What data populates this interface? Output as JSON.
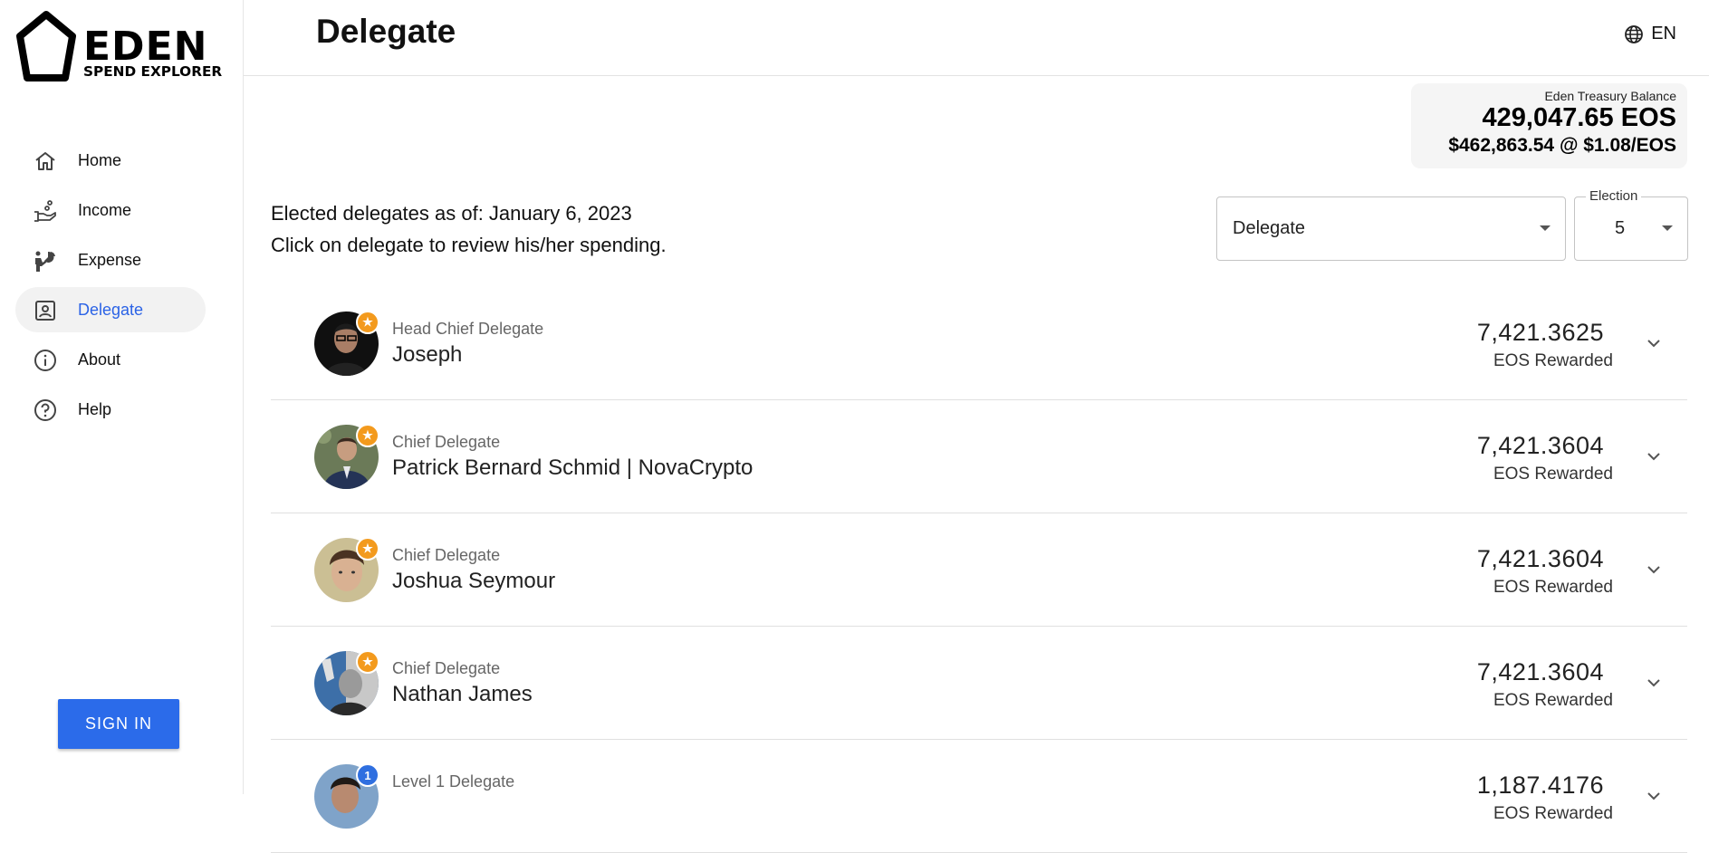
{
  "brand": {
    "name": "EDEN",
    "subtitle": "SPEND EXPLORER"
  },
  "sidebar": {
    "items": [
      {
        "label": "Home",
        "icon": "home-icon",
        "active": false
      },
      {
        "label": "Income",
        "icon": "income-icon",
        "active": false
      },
      {
        "label": "Expense",
        "icon": "expense-icon",
        "active": false
      },
      {
        "label": "Delegate",
        "icon": "delegate-icon",
        "active": true
      },
      {
        "label": "About",
        "icon": "info-icon",
        "active": false
      },
      {
        "label": "Help",
        "icon": "help-icon",
        "active": false
      }
    ],
    "signin_label": "SIGN IN"
  },
  "header": {
    "title": "Delegate",
    "language": "EN"
  },
  "treasury": {
    "label": "Eden Treasury Balance",
    "eos": "429,047.65 EOS",
    "usd": "$462,863.54 @ $1.08/EOS"
  },
  "intro": {
    "line1": "Elected delegates as of: January 6, 2023",
    "line2": "Click on delegate to review his/her spending."
  },
  "filters": {
    "view_value": "Delegate",
    "election_label": "Election",
    "election_value": "5"
  },
  "delegates": [
    {
      "role": "Head Chief Delegate",
      "name": "Joseph",
      "amount": "7,421.3625",
      "amount_label": "EOS Rewarded",
      "badge": "star"
    },
    {
      "role": "Chief Delegate",
      "name": "Patrick Bernard Schmid | NovaCrypto",
      "amount": "7,421.3604",
      "amount_label": "EOS Rewarded",
      "badge": "star"
    },
    {
      "role": "Chief Delegate",
      "name": "Joshua Seymour",
      "amount": "7,421.3604",
      "amount_label": "EOS Rewarded",
      "badge": "star"
    },
    {
      "role": "Chief Delegate",
      "name": "Nathan James",
      "amount": "7,421.3604",
      "amount_label": "EOS Rewarded",
      "badge": "star"
    },
    {
      "role": "Level 1 Delegate",
      "name": "",
      "amount": "1,187.4176",
      "amount_label": "EOS Rewarded",
      "badge": "1"
    }
  ],
  "colors": {
    "accent": "#2b63e6",
    "button": "#2b6bea",
    "star_badge": "#f39a1d",
    "level_badge": "#2f6fe0"
  }
}
